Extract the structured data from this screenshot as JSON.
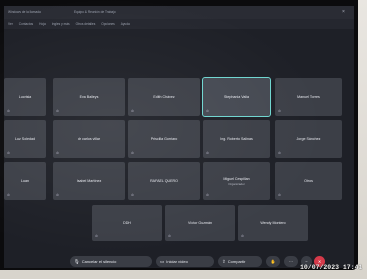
{
  "window": {
    "tabs": [
      "Windows de la llamada",
      "Equipo & Reunión de Trabajo"
    ],
    "menu": [
      "Ver",
      "Contactos",
      "Hoja",
      "Ingles y más",
      "Otros detalles",
      "Opciones",
      "Ayuda"
    ]
  },
  "participants": [
    {
      "name": "Lucrisia",
      "sub": ""
    },
    {
      "name": "Eva Balleys",
      "sub": ""
    },
    {
      "name": "Edith Chávez",
      "sub": ""
    },
    {
      "name": "Stephania Valia",
      "sub": ""
    },
    {
      "name": "Manuel Torres",
      "sub": ""
    },
    {
      "name": "Luz Soledad",
      "sub": ""
    },
    {
      "name": "dr carlos villar",
      "sub": ""
    },
    {
      "name": "Priscilla Gorriaro",
      "sub": ""
    },
    {
      "name": "Ing. Roberto Salinas",
      "sub": ""
    },
    {
      "name": "Jorge Sánchez",
      "sub": ""
    },
    {
      "name": "Luan",
      "sub": ""
    },
    {
      "name": "Isabel Martínez",
      "sub": ""
    },
    {
      "name": "RAFAEL QUERO",
      "sub": ""
    },
    {
      "name": "Miguel Cespillan",
      "sub": "Organizador"
    },
    {
      "name": "Otros",
      "sub": ""
    },
    {
      "name": "DDH",
      "sub": ""
    },
    {
      "name": "Víctor Guzmán",
      "sub": ""
    },
    {
      "name": "Wendy Montero",
      "sub": ""
    }
  ],
  "controls": {
    "mute_label": "Cancelar el silencio",
    "video_label": "Iniciar vídeo",
    "share_label": "Compartir"
  },
  "timestamp": "10/07/2023 17:41",
  "colors": {
    "speaker_outline": "#6fd6d0",
    "leave": "#d63a4a",
    "tile": "#3c3f47"
  }
}
